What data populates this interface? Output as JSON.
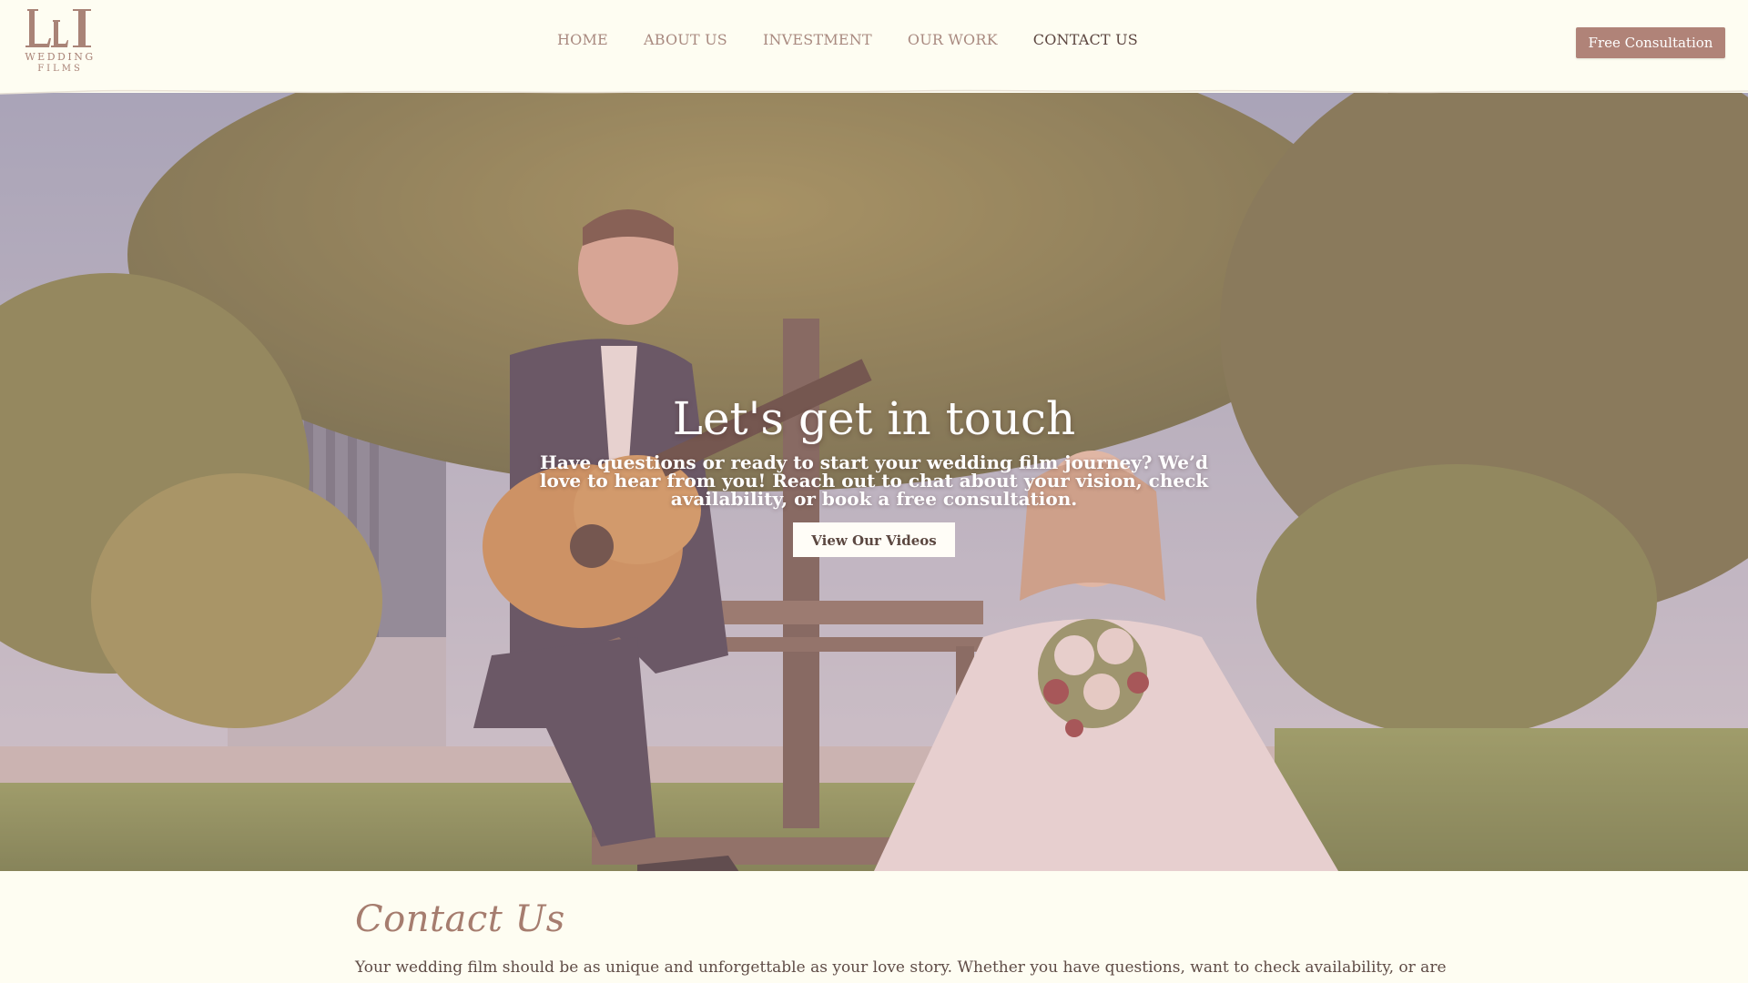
{
  "brand": {
    "logo_line1": "WEDDING",
    "logo_line2": "FILMS",
    "logo_mark": "LI monogram"
  },
  "nav": {
    "items": [
      {
        "label": "HOME"
      },
      {
        "label": "ABOUT US"
      },
      {
        "label": "INVESTMENT"
      },
      {
        "label": "OUR WORK"
      },
      {
        "label": "CONTACT US"
      }
    ],
    "active_index": 4,
    "cta_label": "Free Consultation"
  },
  "hero": {
    "title": "Let's get in touch",
    "subtitle": "Have questions or ready to start your wedding film journey? We’d love to hear from you! Reach out to chat about your vision, check availability, or book a free consultation.",
    "button_label": "View Our Videos",
    "image_desc": "photo: groom playing guitar for bride seated on bench in park"
  },
  "contact": {
    "heading": "Contact Us",
    "intro": "Your wedding film should be as unique and unforgettable as your love story. Whether you have questions, want to check availability, or are"
  },
  "colors": {
    "background": "#fefdf2",
    "accent": "#b08378",
    "nav_text": "#a98a80",
    "nav_active": "#5c4640",
    "heading_script": "#a67d6f",
    "hero_overlay": "#d6a0a5"
  }
}
